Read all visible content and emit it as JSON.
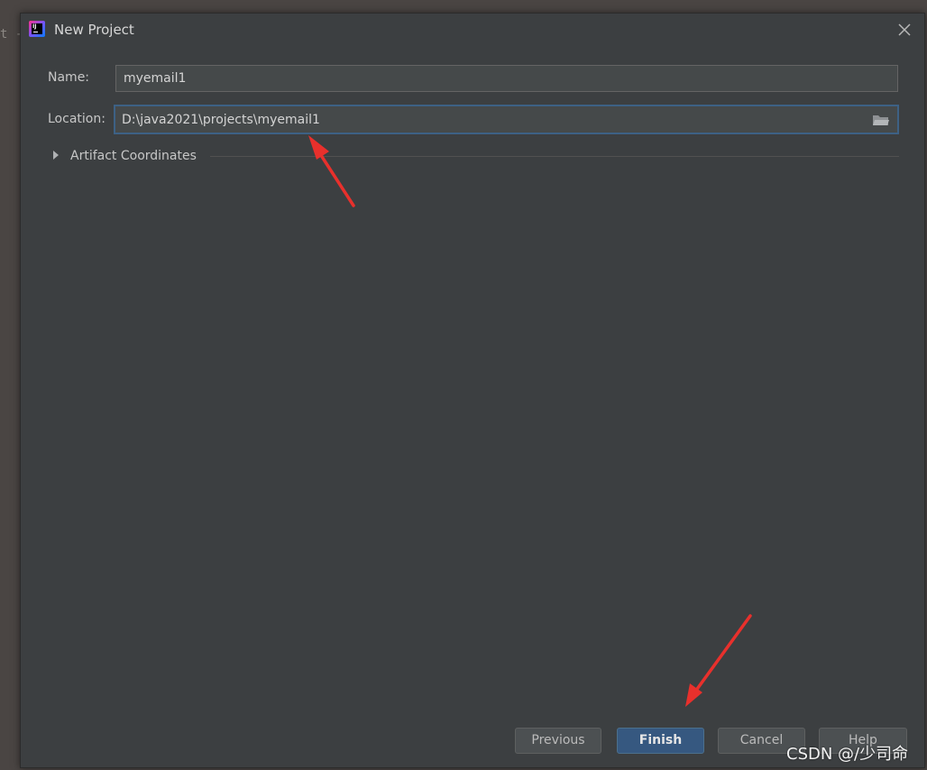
{
  "backdrop": {
    "text": "t -"
  },
  "dialog": {
    "title": "New Project",
    "close_icon": "close-icon",
    "app_icon": "intellij-idea-icon",
    "app_icon_text": "IJ"
  },
  "form": {
    "name_label": "Name:",
    "name_value": "myemail1",
    "location_label": "Location:",
    "location_value": "D:\\java2021\\projects\\myemail1",
    "browse_icon": "folder-icon"
  },
  "artifact": {
    "label": "Artifact Coordinates",
    "expanded": false
  },
  "buttons": {
    "previous": "Previous",
    "finish": "Finish",
    "cancel": "Cancel",
    "help": "Help"
  },
  "watermark": {
    "text": "CSDN @/少司命"
  },
  "colors": {
    "dialog_bg": "#3c3f41",
    "field_bg": "#45494a",
    "focus_border": "#3d6185",
    "primary_button": "#365880",
    "annotation_arrow": "#e8302c"
  }
}
